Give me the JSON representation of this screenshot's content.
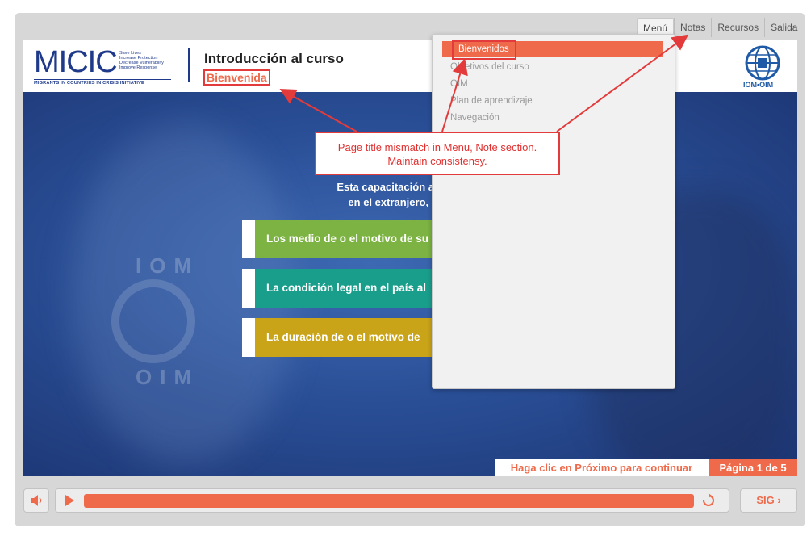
{
  "top_tabs": [
    "Menú",
    "Notas",
    "Recursos",
    "Salida"
  ],
  "header": {
    "logo_text": "MICIC",
    "logo_tagline": "Save Lives\nIncrease Protection\nDecrease Vulnerability\nImprove Response",
    "logo_strip": "MIGRANTS IN COUNTRIES IN CRISIS INITIATIVE",
    "course_title": "Introducción al curso",
    "page_title": "Bienvenida",
    "iom_caption": "IOM•OIM"
  },
  "slide": {
    "intro_line1": "Esta capacitación  aplica para",
    "intro_line2": "en el extranjero, indepen",
    "watermark_top": "IOM",
    "watermark_bottom": "OIM",
    "bars": [
      "Los medio de o el motivo de su",
      "La condición legal en el país al",
      "La duración de o el motivo de"
    ],
    "continue_text": "Haga clic en Próximo para continuar",
    "page_indicator": "Página 1 de 5"
  },
  "menu": {
    "items": [
      "Bienvenidos",
      "Objetivos del curso",
      "OIM",
      "Plan de aprendizaje",
      "Navegación"
    ],
    "active_index": 0
  },
  "annotation": {
    "line1": "Page title mismatch in Menu, Note section.",
    "line2": "Maintain consistensy."
  },
  "controls": {
    "next_label": "SIG",
    "progress_fraction": 1.0
  },
  "colors": {
    "accent": "#ef6a4a",
    "annotation_red": "#e33b3b",
    "bar_green": "#7cb342",
    "bar_teal": "#1a9e8c",
    "bar_gold": "#c9a418",
    "brand_blue": "#1f3a8a"
  },
  "icons": [
    "volume-icon",
    "play-icon",
    "replay-icon",
    "chevron-right-icon",
    "iom-globe-icon"
  ]
}
